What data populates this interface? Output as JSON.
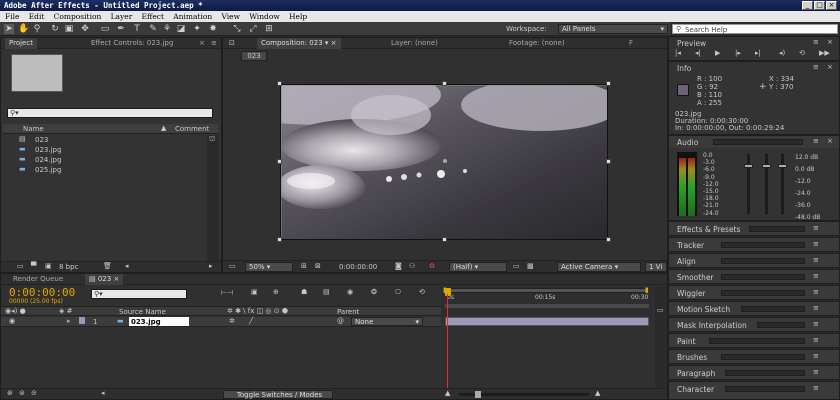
{
  "window": {
    "title": "Adobe After Effects - Untitled Project.aep *"
  },
  "menu": [
    "File",
    "Edit",
    "Composition",
    "Layer",
    "Effect",
    "Animation",
    "View",
    "Window",
    "Help"
  ],
  "workspace": {
    "label": "Workspace:",
    "value": "All Panels"
  },
  "search_help": {
    "placeholder": "Search Help"
  },
  "project": {
    "tab_project": "Project",
    "tab_effect_controls": "Effect Controls: 023.jpg",
    "columns": {
      "name": "Name",
      "comment": "Comment"
    },
    "items": [
      {
        "name": "023",
        "type": "comp"
      },
      {
        "name": "023.jpg",
        "type": "image"
      },
      {
        "name": "024.jpg",
        "type": "image"
      },
      {
        "name": "025.jpg",
        "type": "image"
      }
    ],
    "bpc": "8 bpc"
  },
  "viewer": {
    "tab_comp": "Composition: 023",
    "tab_layer": "Layer: (none)",
    "tab_footage": "Footage: (none)",
    "tab_extra": "F",
    "comp_badge": "023",
    "zoom": "50%",
    "timecode": "0:00:00:00",
    "resolution": "(Half)",
    "camera": "Active Camera",
    "views": "1 Vi"
  },
  "timeline": {
    "tab_render": "Render Queue",
    "tab_comp": "023",
    "timecode": "0:00:00:00",
    "frame_info": "00000 (25.00 fps)",
    "source_name_header": "Source Name",
    "parent_header": "Parent",
    "ruler": [
      "0s",
      "00:15s",
      "00:30"
    ],
    "layer": {
      "number": "1",
      "name": "023.jpg",
      "parent": "None"
    },
    "toggle_label": "Toggle Switches / Modes"
  },
  "preview": {
    "title": "Preview"
  },
  "info": {
    "title": "Info",
    "r": "R : 100",
    "g": "G : 92",
    "b": "B : 110",
    "a": "A : 255",
    "x": "X : 334",
    "y": "Y : 370",
    "file": "023.jpg",
    "duration": "Duration: 0:00:30:00",
    "inout": "In: 0:00:00:00, Out: 0:00:29:24",
    "swatch": "#6e6278"
  },
  "audio": {
    "title": "Audio",
    "left_scale": [
      "0.0",
      "-3.0",
      "-6.0",
      "-9.0",
      "-12.0",
      "-15.0",
      "-18.0",
      "-21.0",
      "-24.0"
    ],
    "right_scale": [
      "12.0 dB",
      "0.0 dB",
      "-12.0",
      "-24.0",
      "-36.0",
      "-48.0 dB"
    ]
  },
  "panels": [
    "Effects & Presets",
    "Tracker",
    "Align",
    "Smoother",
    "Wiggler",
    "Motion Sketch",
    "Mask Interpolation",
    "Paint",
    "Brushes",
    "Paragraph",
    "Character"
  ],
  "colors": {
    "timecode": "#e2a800",
    "cti": "#e03030",
    "layer_bar": "#9a9ab8"
  }
}
